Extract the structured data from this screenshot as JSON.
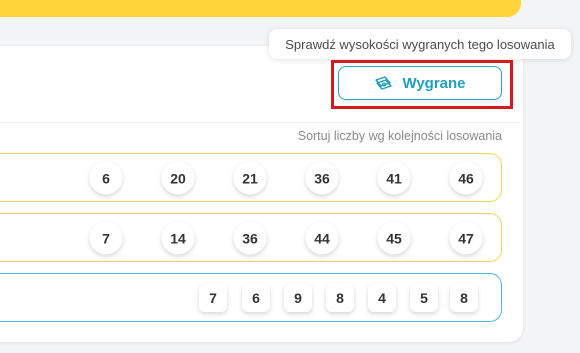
{
  "tooltip": {
    "text": "Sprawdź wysokości wygranych tego losowania"
  },
  "winnings_button": {
    "label": "Wygrane",
    "icon": "money-icon"
  },
  "sort": {
    "label": "Sortuj liczby wg kolejności losowania"
  },
  "rows": [
    {
      "type": "balls",
      "numbers": [
        "6",
        "20",
        "21",
        "36",
        "41",
        "46"
      ]
    },
    {
      "type": "balls",
      "numbers": [
        "7",
        "14",
        "36",
        "44",
        "45",
        "47"
      ]
    },
    {
      "type": "tiles",
      "numbers": [
        "7",
        "6",
        "9",
        "8",
        "4",
        "5",
        "8"
      ]
    }
  ],
  "colors": {
    "banner": "#ffd43b",
    "accent": "#1f9fc2",
    "highlight": "#d71920",
    "yellow_border": "#f6d65a",
    "blue_border": "#4fb7e0"
  }
}
